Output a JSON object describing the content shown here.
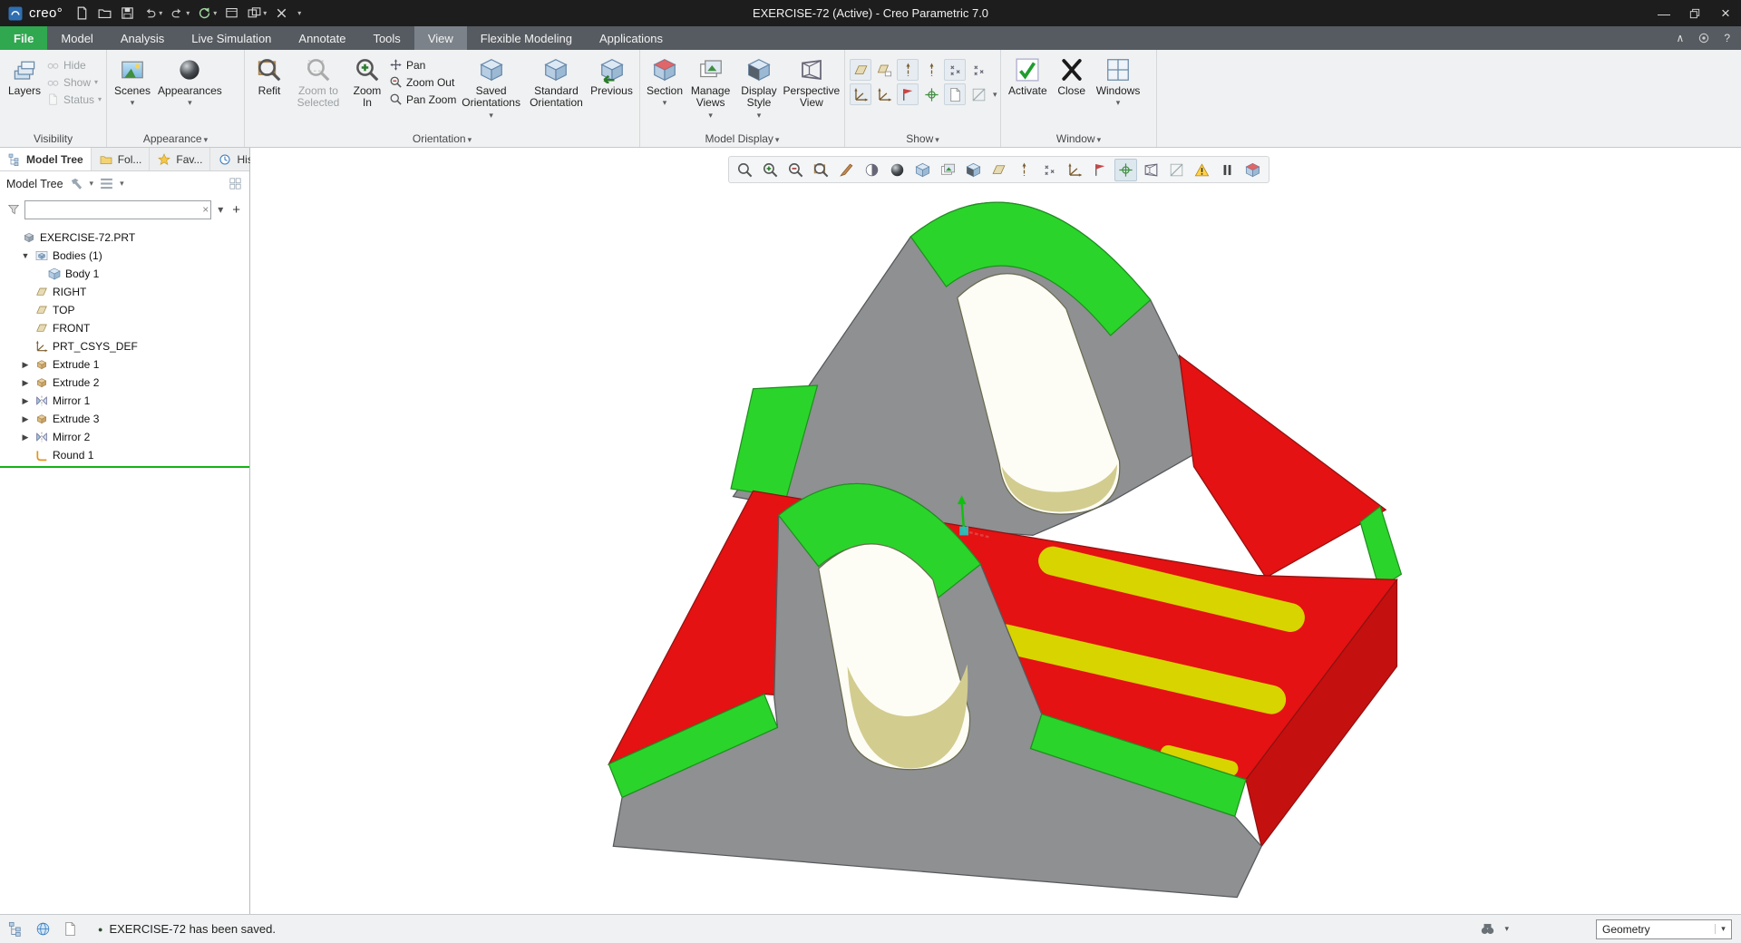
{
  "window": {
    "brand": "creo°",
    "title": "EXERCISE-72 (Active) - Creo Parametric 7.0"
  },
  "glyphs": {
    "caret": "▾",
    "chevron_up": "∧",
    "question": "?",
    "minimize": "—",
    "close": "×",
    "plus": "+",
    "clear": "×",
    "tree_open": "▼",
    "tree_closed": "▶"
  },
  "qat": [
    {
      "name": "new-file",
      "icon": "q-new"
    },
    {
      "name": "open-file",
      "icon": "q-open"
    },
    {
      "name": "save",
      "icon": "q-save"
    },
    {
      "name": "undo",
      "icon": "q-undo",
      "caret": true
    },
    {
      "name": "redo",
      "icon": "q-redo",
      "caret": true
    },
    {
      "name": "regenerate",
      "icon": "q-regen",
      "caret": true
    },
    {
      "name": "window-display",
      "icon": "q-grid1"
    },
    {
      "name": "window-layout",
      "icon": "q-grid2",
      "caret": true
    },
    {
      "name": "close-window",
      "icon": "q-close"
    },
    {
      "name": "customize-qat",
      "icon": "",
      "caret": true
    }
  ],
  "menu": {
    "tabs": [
      "File",
      "Model",
      "Analysis",
      "Live Simulation",
      "Annotate",
      "Tools",
      "View",
      "Flexible Modeling",
      "Applications"
    ],
    "active_tab": "View"
  },
  "ribbon": {
    "visibility": {
      "group": "Visibility",
      "layers": "Layers",
      "hide": "Hide",
      "show": "Show",
      "status": "Status"
    },
    "appearance": {
      "group": "Appearance",
      "scenes": "Scenes",
      "appearances": "Appearances"
    },
    "orientation": {
      "group": "Orientation",
      "refit": "Refit",
      "zoom_to_selected": "Zoom to Selected",
      "zoom_in": "Zoom In",
      "pan": "Pan",
      "zoom_out": "Zoom Out",
      "pan_zoom": "Pan Zoom",
      "saved_orientations": "Saved Orientations",
      "standard_orientation": "Standard Orientation",
      "previous": "Previous"
    },
    "model_display": {
      "group": "Model Display",
      "section": "Section",
      "manage_views": "Manage Views",
      "display_style": "Display Style",
      "perspective_view": "Perspective View"
    },
    "show": {
      "group": "Show"
    },
    "window_group": {
      "group": "Window",
      "activate": "Activate",
      "close": "Close",
      "windows": "Windows"
    }
  },
  "show_icons": [
    {
      "name": "datum-plane-display",
      "icon": "s-plane"
    },
    {
      "name": "plane-tag-display",
      "icon": "s-plane-tag"
    },
    {
      "name": "axis-display",
      "icon": "s-axis"
    },
    {
      "name": "axis-tag-display",
      "icon": "s-axis"
    },
    {
      "name": "point-display",
      "icon": "s-points"
    },
    {
      "name": "point-tag-display",
      "icon": "s-points"
    },
    {
      "name": "csys-display",
      "icon": "s-csys"
    },
    {
      "name": "csys-tag-display",
      "icon": "s-csys"
    },
    {
      "name": "annotation-display",
      "icon": "s-ann"
    },
    {
      "name": "spin-center-display",
      "icon": "s-spin"
    },
    {
      "name": "notes-display",
      "icon": "s-doc"
    },
    {
      "name": "names-display",
      "icon": "s-slope"
    }
  ],
  "graphics_toolbar": [
    {
      "name": "zoom-region",
      "icon": "s-mag"
    },
    {
      "name": "zoom-in",
      "icon": "s-mag-plus"
    },
    {
      "name": "zoom-out",
      "icon": "s-mag-minus"
    },
    {
      "name": "refit",
      "icon": "s-mag-box"
    },
    {
      "name": "repaint",
      "icon": "s-brush"
    },
    {
      "name": "display-settings",
      "icon": "s-adjust"
    },
    {
      "name": "enhanced-realism",
      "icon": "s-sphere"
    },
    {
      "name": "saved-views",
      "icon": "s-cube"
    },
    {
      "name": "view-manager",
      "icon": "s-gallery"
    },
    {
      "name": "display-style",
      "icon": "s-dstyle"
    },
    {
      "name": "datum-plane-toggle",
      "icon": "s-plane"
    },
    {
      "name": "datum-axis-toggle",
      "icon": "s-axis"
    },
    {
      "name": "datum-point-toggle",
      "icon": "s-points"
    },
    {
      "name": "csys-toggle",
      "icon": "s-csys"
    },
    {
      "name": "annotation-toggle",
      "icon": "s-ann"
    },
    {
      "name": "spin-center-toggle",
      "icon": "s-spin",
      "toggled": true
    },
    {
      "name": "orient-mode",
      "icon": "s-persp"
    },
    {
      "name": "sketch-view",
      "icon": "s-slope"
    },
    {
      "name": "analysis-warning",
      "icon": "s-warn"
    },
    {
      "name": "pause-simulation",
      "icon": "s-pause"
    },
    {
      "name": "clipping-toggle",
      "icon": "s-section"
    }
  ],
  "left_panel": {
    "tabs": [
      {
        "label": "Model Tree",
        "icon": "s-tree"
      },
      {
        "label": "Fol...",
        "icon": "s-folder"
      },
      {
        "label": "Fav...",
        "icon": "s-star"
      },
      {
        "label": "His...",
        "icon": "s-history"
      }
    ],
    "header": {
      "title": "Model Tree"
    },
    "search": {
      "value": "",
      "placeholder": ""
    },
    "tree": [
      {
        "label": "EXERCISE-72.PRT",
        "icon": "part",
        "indent": 0,
        "exp": ""
      },
      {
        "label": "Bodies (1)",
        "icon": "bodies",
        "indent": 1,
        "exp": "open"
      },
      {
        "label": "Body 1",
        "icon": "body",
        "indent": 2,
        "exp": ""
      },
      {
        "label": "RIGHT",
        "icon": "plane",
        "indent": 1,
        "exp": ""
      },
      {
        "label": "TOP",
        "icon": "plane",
        "indent": 1,
        "exp": ""
      },
      {
        "label": "FRONT",
        "icon": "plane",
        "indent": 1,
        "exp": ""
      },
      {
        "label": "PRT_CSYS_DEF",
        "icon": "csys",
        "indent": 1,
        "exp": ""
      },
      {
        "label": "Extrude 1",
        "icon": "extrude",
        "indent": 1,
        "exp": "closed"
      },
      {
        "label": "Extrude 2",
        "icon": "extrude",
        "indent": 1,
        "exp": "closed"
      },
      {
        "label": "Mirror 1",
        "icon": "mirror",
        "indent": 1,
        "exp": "closed"
      },
      {
        "label": "Extrude 3",
        "icon": "extrude",
        "indent": 1,
        "exp": "closed"
      },
      {
        "label": "Mirror 2",
        "icon": "mirror",
        "indent": 1,
        "exp": "closed"
      },
      {
        "label": "Round 1",
        "icon": "round",
        "indent": 1,
        "exp": "",
        "insert_here": true
      }
    ]
  },
  "status_bar": {
    "icons": [
      {
        "name": "model-tree-toggle",
        "icon": "s-tree"
      },
      {
        "name": "web-browser-toggle",
        "icon": "s-globe"
      },
      {
        "name": "full-screen-toggle",
        "icon": "s-doc"
      }
    ],
    "bullet": "●",
    "message": "EXERCISE-72 has been saved.",
    "selection_filter": "Geometry"
  },
  "model_colors": {
    "gray": "#8e9092",
    "red": "#e41212",
    "green": "#2bd42b",
    "yellow": "#d8d400",
    "hole_inner": "#d2cc8f",
    "background": "#ffffff"
  }
}
